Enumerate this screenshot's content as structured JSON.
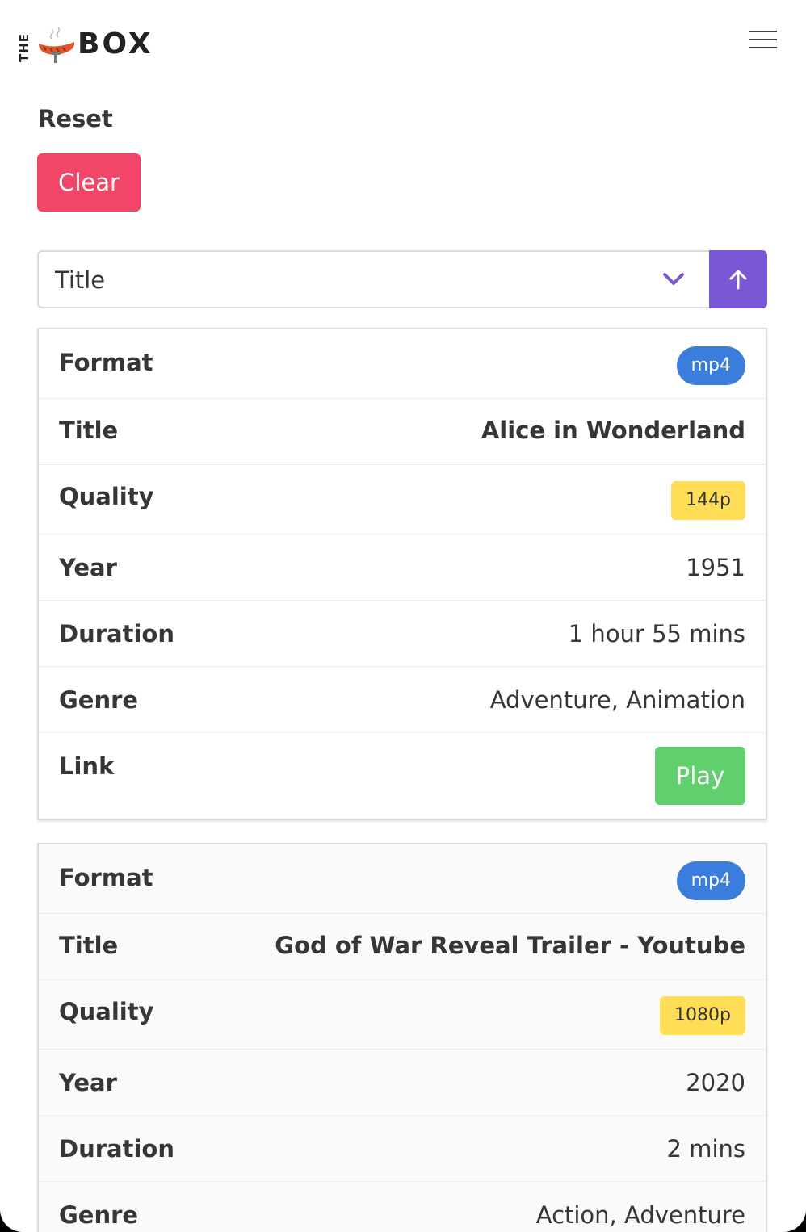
{
  "navbar": {
    "logo_the": "THE",
    "logo_box": "BOX"
  },
  "reset": {
    "label": "Reset",
    "clear_button": "Clear"
  },
  "sort": {
    "selected": "Title",
    "direction_icon": "arrow-up-icon",
    "accent_color": "#7957d5"
  },
  "videos": [
    {
      "format_label": "Format",
      "format": "mp4",
      "title_label": "Title",
      "title": "Alice in Wonderland",
      "quality_label": "Quality",
      "quality": "144p",
      "year_label": "Year",
      "year": "1951",
      "duration_label": "Duration",
      "duration": "1 hour 55 mins",
      "genre_label": "Genre",
      "genre": "Adventure, Animation",
      "link_label": "Link",
      "link_button": "Play"
    },
    {
      "format_label": "Format",
      "format": "mp4",
      "title_label": "Title",
      "title": "God of War Reveal Trailer - Youtube",
      "quality_label": "Quality",
      "quality": "1080p",
      "year_label": "Year",
      "year": "2020",
      "duration_label": "Duration",
      "duration": "2 mins",
      "genre_label": "Genre",
      "genre": "Action, Adventure"
    }
  ],
  "colors": {
    "clear_button": "#f14668",
    "format_tag": "#3b7ddd",
    "quality_tag": "#ffdd57",
    "play_button": "#62cf6e"
  }
}
